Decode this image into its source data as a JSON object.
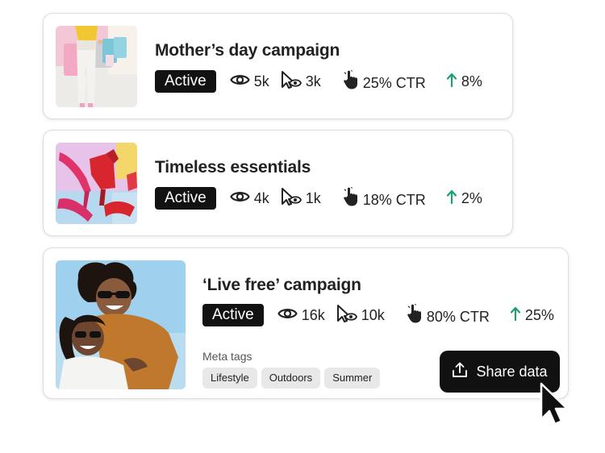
{
  "campaigns": [
    {
      "title": "Mother’s day campaign",
      "status": "Active",
      "views": "5k",
      "clicks": "3k",
      "ctr": "25% CTR",
      "trend": "8%",
      "trend_direction": "up",
      "thumbnail": "shopping-bags-photo"
    },
    {
      "title": "Timeless essentials",
      "status": "Active",
      "views": "4k",
      "clicks": "1k",
      "ctr": "18% CTR",
      "trend": "2%",
      "trend_direction": "up",
      "thumbnail": "red-heels-photo"
    },
    {
      "title": "‘Live free’ campaign",
      "status": "Active",
      "views": "16k",
      "clicks": "10k",
      "ctr": "80% CTR",
      "trend": "25%",
      "trend_direction": "up",
      "thumbnail": "two-women-photo",
      "meta_label": "Meta tags",
      "tags": [
        "Lifestyle",
        "Outdoors",
        "Summer"
      ],
      "share_label": "Share data"
    }
  ],
  "icons": {
    "views": "eye-icon",
    "clicks": "cursor-click-icon",
    "ctr": "hand-pointer-icon",
    "trend": "arrow-up-icon",
    "share": "share-upload-icon",
    "pointer": "mouse-pointer-icon"
  },
  "colors": {
    "badge_bg": "#121212",
    "trend_up": "#1f9d6b",
    "button_bg": "#111111",
    "chip_bg": "#e8e8e8"
  }
}
